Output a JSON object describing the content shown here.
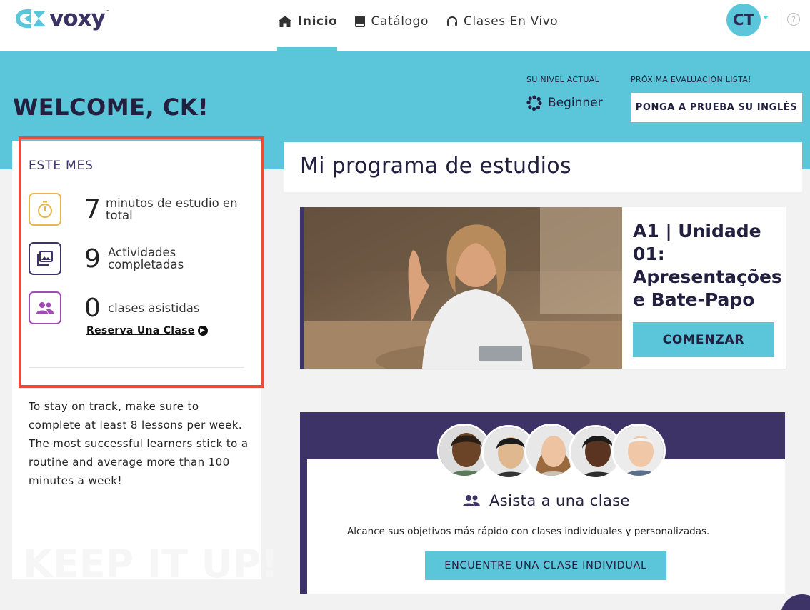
{
  "brand": {
    "name": "voxy"
  },
  "nav": {
    "items": [
      {
        "label": "Inicio",
        "icon": "home-icon",
        "active": true
      },
      {
        "label": "Catálogo",
        "icon": "book-icon",
        "active": false
      },
      {
        "label": "Clases En Vivo",
        "icon": "headset-icon",
        "active": false
      }
    ]
  },
  "user": {
    "initials": "CT",
    "help_glyph": "?"
  },
  "hero": {
    "welcome": "WELCOME, CK!",
    "level_label": "SU NIVEL ACTUAL",
    "level_value": "Beginner",
    "eval_label": "PRÓXIMA EVALUACIÓN LISTA!",
    "eval_button": "PONGA A PRUEBA SU INGLÉS"
  },
  "stats": {
    "title": "ESTE MES",
    "items": [
      {
        "value": "7",
        "label": "minutos de estudio en total",
        "icon": "stopwatch-icon",
        "color": "#e8b54a"
      },
      {
        "value": "9",
        "label": "Actividades completadas",
        "icon": "gallery-icon",
        "color": "#3e3367"
      },
      {
        "value": "0",
        "label": "clases asistidas",
        "icon": "people-icon",
        "color": "#a24bb8"
      }
    ],
    "reserve_link": "Reserva Una Clase",
    "tip": "To stay on track, make sure to complete at least 8 lessons per week. The most successful learners stick to a routine and average more than 100 minutes a week!",
    "watermark": "KEEP IT UP!"
  },
  "program": {
    "title": "Mi programa de estudios",
    "lesson_title": "A1 | Unidade 01: Apresentações e Bate-Papo",
    "start_button": "COMENZAR"
  },
  "live_class": {
    "title": "Asista a una clase",
    "subtitle": "Alcance sus objetivos más rápido con clases individuales y personalizadas.",
    "button": "ENCUENTRE UNA CLASE INDIVIDUAL"
  },
  "colors": {
    "accent": "#5bc5d9",
    "brand_dark": "#3e3367",
    "highlight": "#e74c3c"
  }
}
